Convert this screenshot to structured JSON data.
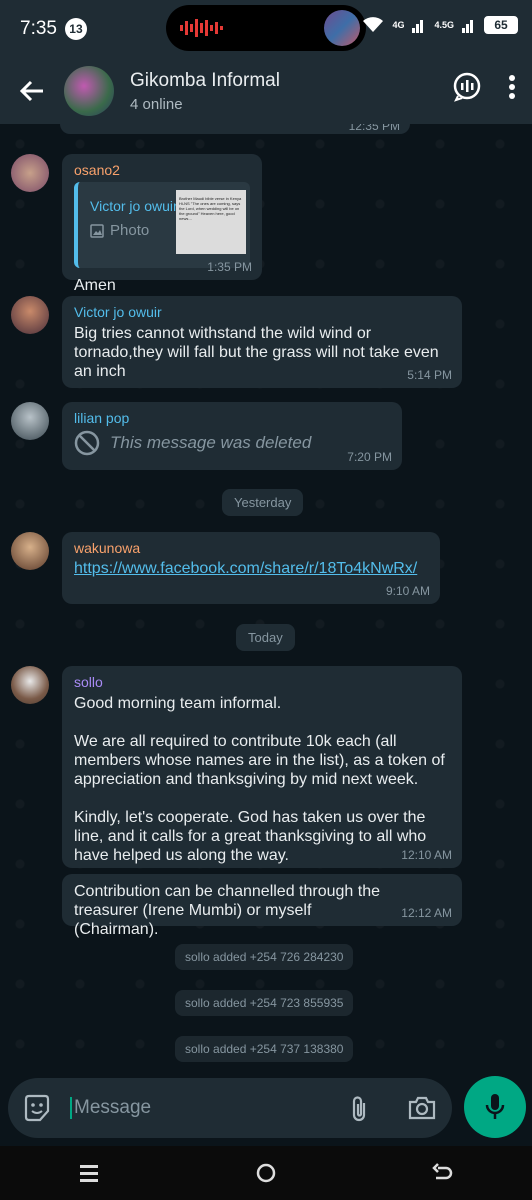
{
  "status": {
    "time": "7:35",
    "notif_count": "13",
    "net1": "4G",
    "net2": "4.5G",
    "battery": "65"
  },
  "header": {
    "title": "Gikomba Informal",
    "subtitle": "4 online"
  },
  "messages": [
    {
      "time_partial": "12:35 PM"
    },
    {
      "sender": "osano2",
      "quote_name": "Victor jo owuir",
      "quote_type": "Photo",
      "thumb_text": "Brother Maudi bible verse in Kenya Hi-NS \"The ones are coming, says the Lord, when wedding will be on the ground\" Heaven here, good news…",
      "text": "Amen",
      "time": "1:35 PM"
    },
    {
      "sender": "Victor jo owuir",
      "text": "Big tries cannot withstand the wild wind or tornado,they will fall but the grass will not take even an inch",
      "time": "5:14 PM"
    },
    {
      "sender": "lilian  pop",
      "text": "This message was deleted",
      "time": "7:20 PM"
    },
    {
      "sender": "wakunowa",
      "text": "https://www.facebook.com/share/r/18To4kNwRx/",
      "time": "9:10 AM"
    },
    {
      "sender": "sollo",
      "text": "Good morning team informal.\n\nWe are all required to contribute 10k each (all members whose names are in the list), as a token of appreciation and thanksgiving by mid next week.\n\nKindly, let's cooperate. God has taken us over the line, and it calls for a great thanksgiving to all who have helped us along the way.",
      "time": "12:10 AM"
    },
    {
      "text": "Contribution can be channelled through the treasurer (Irene Mumbi) or myself (Chairman).",
      "time": "12:12 AM"
    }
  ],
  "dates": {
    "yesterday": "Yesterday",
    "today": "Today"
  },
  "system": [
    "sollo added +254 726 284230",
    "sollo added +254 723 855935",
    "sollo added +254 737 138380"
  ],
  "composer": {
    "placeholder": "Message"
  },
  "colors": {
    "accent": "#00a884",
    "link": "#53bdeb",
    "bubble": "#1f2c34",
    "bg": "#0b141a"
  }
}
